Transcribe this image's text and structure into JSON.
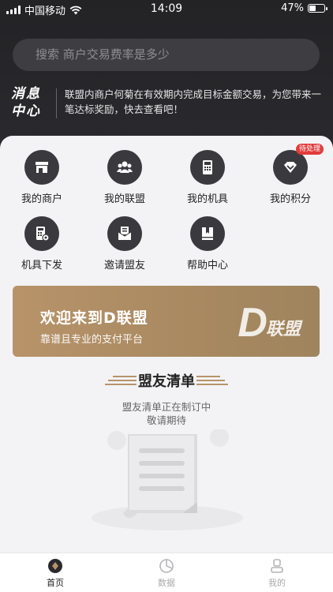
{
  "status_bar": {
    "carrier": "中国移动",
    "time": "14:09",
    "battery": "47%",
    "battery_level": 0.47
  },
  "search": {
    "placeholder": "搜索 商户交易费率是多少"
  },
  "notice": {
    "logo_line1": "消息",
    "logo_line2": "中心",
    "text": "联盟内商户何菊在有效期内完成目标金额交易，为您带来一笔达标奖励，快去查看吧！"
  },
  "grid": {
    "items": [
      {
        "label": "我的商户",
        "icon": "store-icon"
      },
      {
        "label": "我的联盟",
        "icon": "group-icon"
      },
      {
        "label": "我的机具",
        "icon": "pos-terminal-icon"
      },
      {
        "label": "我的积分",
        "icon": "points-diamond-icon",
        "badge": "待处理"
      },
      {
        "label": "机具下发",
        "icon": "pos-settings-icon"
      },
      {
        "label": "邀请盟友",
        "icon": "invite-mail-icon"
      },
      {
        "label": "帮助中心",
        "icon": "help-book-icon"
      }
    ]
  },
  "banner": {
    "title": "欢迎来到D联盟",
    "subtitle": "靠谱且专业的支付平台",
    "logo_d": "D",
    "logo_text": "联盟"
  },
  "ally_list": {
    "title": "盟友清单",
    "empty_line1": "盟友清单正在制订中",
    "empty_line2": "敬请期待"
  },
  "tabbar": {
    "tabs": [
      {
        "label": "首页",
        "icon": "home-icon",
        "active": true
      },
      {
        "label": "数据",
        "icon": "chart-pie-icon",
        "active": false
      },
      {
        "label": "我的",
        "icon": "user-icon",
        "active": false
      }
    ]
  },
  "colors": {
    "header_bg": "#232326",
    "accent_gold": "#b8936a",
    "badge_red": "#e23b3b",
    "icon_circle": "#3a3a3e"
  }
}
